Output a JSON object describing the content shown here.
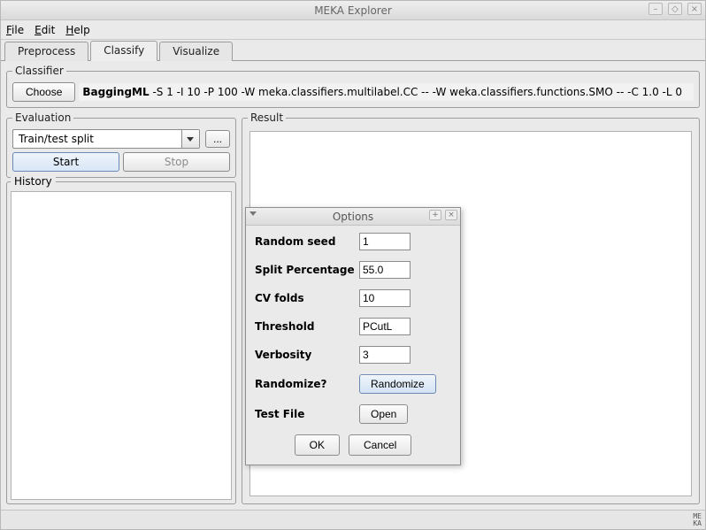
{
  "window": {
    "title": "MEKA Explorer"
  },
  "menubar": {
    "file": "File",
    "edit": "Edit",
    "help": "Help"
  },
  "tabs": {
    "preprocess": "Preprocess",
    "classify": "Classify",
    "visualize": "Visualize"
  },
  "classifier": {
    "legend": "Classifier",
    "choose": "Choose",
    "name": "BaggingML",
    "args": " -S 1 -I 10 -P 100 -W meka.classifiers.multilabel.CC -- -W weka.classifiers.functions.SMO -- -C 1.0 -L 0"
  },
  "evaluation": {
    "legend": "Evaluation",
    "mode": "Train/test split",
    "more": "...",
    "start": "Start",
    "stop": "Stop"
  },
  "history": {
    "legend": "History"
  },
  "result": {
    "legend": "Result"
  },
  "dialog": {
    "title": "Options",
    "rows": {
      "random_seed": {
        "label": "Random seed",
        "value": "1"
      },
      "split_pct": {
        "label": "Split Percentage",
        "value": "55.0"
      },
      "cv_folds": {
        "label": "CV folds",
        "value": "10"
      },
      "threshold": {
        "label": "Threshold",
        "value": "PCutL"
      },
      "verbosity": {
        "label": "Verbosity",
        "value": "3"
      },
      "randomize": {
        "label": "Randomize?",
        "button": "Randomize"
      },
      "test_file": {
        "label": "Test File",
        "button": "Open"
      }
    },
    "ok": "OK",
    "cancel": "Cancel"
  },
  "status": {
    "logo": "ME\nKA"
  }
}
